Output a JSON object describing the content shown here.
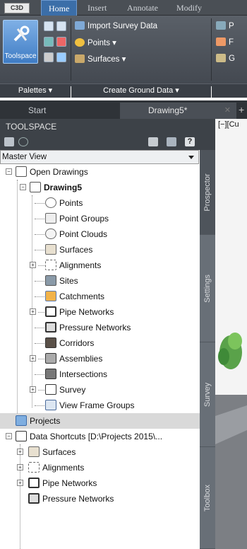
{
  "ribbon": {
    "app_button": "C3D",
    "tabs": [
      "Home",
      "Insert",
      "Annotate",
      "Modify"
    ],
    "toolspace_button": "Toolspace",
    "create_ground_data": [
      "Import Survey Data",
      "Points ▾",
      "Surfaces ▾"
    ],
    "panel_titles": {
      "palettes": "Palettes ▾",
      "create_ground_data": "Create Ground Data ▾"
    },
    "cut_off_items": [
      "P",
      "F",
      "G"
    ]
  },
  "file_tabs": [
    {
      "label": "Start"
    },
    {
      "label": "Drawing5*"
    }
  ],
  "toolspace": {
    "title": "TOOLSPACE",
    "view_selector": "Master View",
    "side_tabs": [
      "Prospector",
      "Settings",
      "Survey",
      "Toolbox"
    ],
    "tree": [
      {
        "label": "Open Drawings"
      },
      {
        "label": "Drawing5"
      },
      {
        "label": "Points"
      },
      {
        "label": "Point Groups"
      },
      {
        "label": "Point Clouds"
      },
      {
        "label": "Surfaces"
      },
      {
        "label": "Alignments"
      },
      {
        "label": "Sites"
      },
      {
        "label": "Catchments"
      },
      {
        "label": "Pipe Networks"
      },
      {
        "label": "Pressure Networks"
      },
      {
        "label": "Corridors"
      },
      {
        "label": "Assemblies"
      },
      {
        "label": "Intersections"
      },
      {
        "label": "Survey"
      },
      {
        "label": "View Frame Groups"
      },
      {
        "label": "Projects"
      },
      {
        "label": "Data Shortcuts [D:\\Projects 2015\\..."
      },
      {
        "label": "Surfaces"
      },
      {
        "label": "Alignments"
      },
      {
        "label": "Pipe Networks"
      },
      {
        "label": "Pressure Networks"
      }
    ]
  },
  "viewport": {
    "label": "[−][Cu"
  }
}
